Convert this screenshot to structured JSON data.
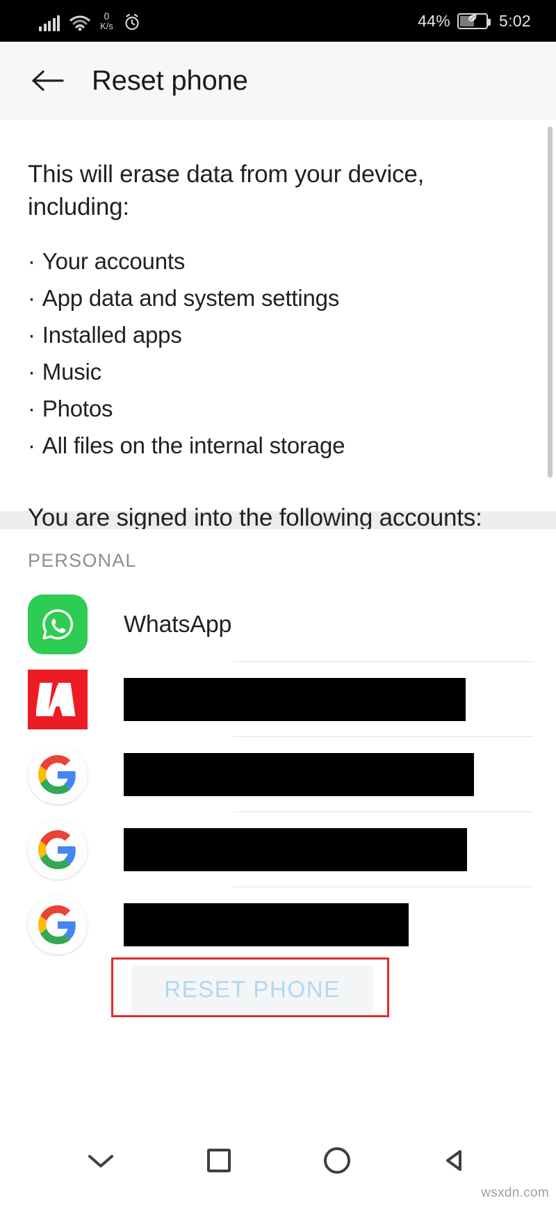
{
  "statusbar": {
    "network_speed_value": "0",
    "network_speed_unit": "K/s",
    "battery_percent": "44%",
    "time": "5:02",
    "icons": [
      "signal-bars-icon",
      "wifi-icon",
      "alarm-clock-icon",
      "battery-saver-icon"
    ]
  },
  "appbar": {
    "back_label": "back-arrow",
    "title": "Reset phone"
  },
  "body": {
    "lead": "This will erase data from your device, including:",
    "bullets": [
      "Your accounts",
      "App data and system settings",
      "Installed apps",
      "Music",
      "Photos",
      "All files on the internal storage"
    ],
    "signed_in_text": "You are signed into the following accounts:"
  },
  "accounts": {
    "section_label": "PERSONAL",
    "items": [
      {
        "icon": "whatsapp-icon",
        "name": "WhatsApp",
        "redacted": false,
        "redacted_width": 0
      },
      {
        "icon": "adobe-icon",
        "name": "",
        "redacted": true,
        "redacted_width": 492
      },
      {
        "icon": "google-icon",
        "name": "",
        "redacted": true,
        "redacted_width": 504
      },
      {
        "icon": "google-icon",
        "name": "",
        "redacted": true,
        "redacted_width": 494
      },
      {
        "icon": "google-icon",
        "name": "",
        "redacted": true,
        "redacted_width": 410
      }
    ]
  },
  "reset_button": {
    "label": "RESET PHONE",
    "state": "disabled",
    "text_color": "#aed9ef",
    "annotation_color": "#e02b2b"
  },
  "navbar": {
    "buttons": [
      "chevron-down-icon",
      "recents-square-icon",
      "home-circle-icon",
      "back-triangle-icon"
    ]
  },
  "watermark": "wsxdn.com"
}
